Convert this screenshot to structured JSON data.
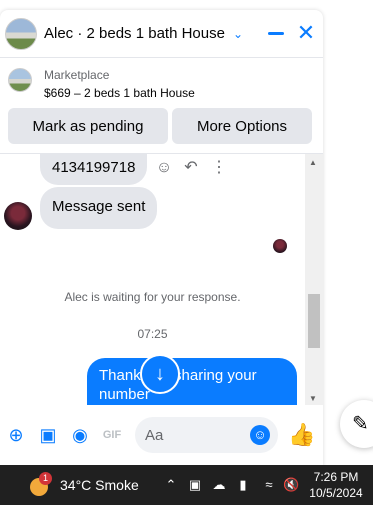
{
  "header": {
    "title": "Alec · 2 beds 1 bath House",
    "chevron_icon": "chevron-down-icon",
    "minimize_icon": "minimize-icon",
    "close_icon": "close-icon",
    "accent_color": "#0a7cff"
  },
  "listing": {
    "source": "Marketplace",
    "description": "$669 – 2 beds 1 bath House"
  },
  "actions": {
    "mark_pending": "Mark as pending",
    "more_options": "More Options"
  },
  "messages": {
    "phone_number": "4134199718",
    "received": "Message sent",
    "status": "Alec is waiting for your response.",
    "timestamp": "07:25",
    "outgoing_text": "Thanks for sharing your number\nI'll text you soon"
  },
  "composer": {
    "placeholder": "Aa"
  },
  "taskbar": {
    "weather_badge": "1",
    "weather": "34°C  Smoke",
    "time": "7:26 PM",
    "date": "10/5/2024"
  }
}
